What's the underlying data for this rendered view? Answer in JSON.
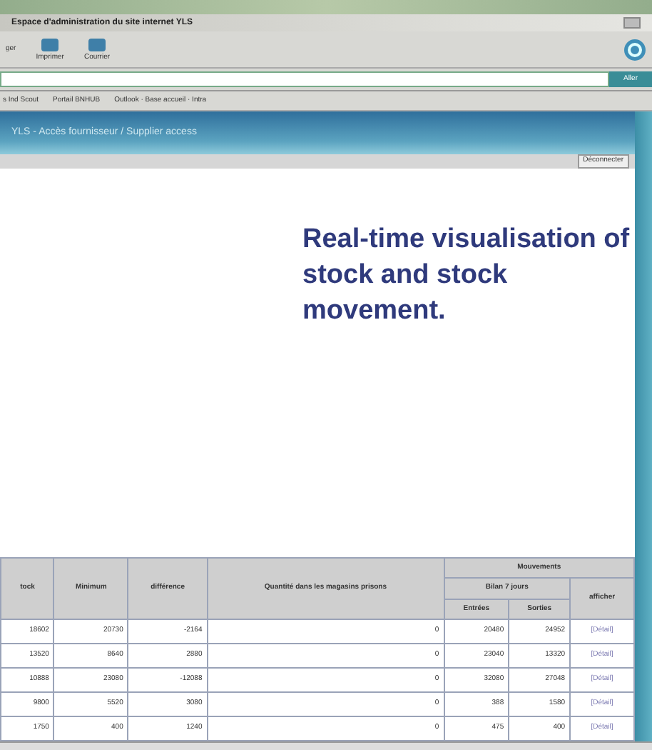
{
  "window": {
    "title": "Espace d'administration du site internet YLS"
  },
  "toolbar": {
    "buttons": [
      {
        "label": "ger"
      },
      {
        "label": "Imprimer"
      },
      {
        "label": "Courrier"
      }
    ]
  },
  "address_bar": {
    "go_button": "Aller"
  },
  "links_bar": {
    "items": [
      "s Ind Scout",
      "Portail BNHUB",
      "Outlook · Base accueil · Intra"
    ]
  },
  "header": {
    "title": "YLS - Accès fournisseur / Supplier access"
  },
  "subbar": {
    "link": "Déconnecter"
  },
  "headline": "Real-time visualisation of stock and stock movement.",
  "table": {
    "group_header": "Mouvements",
    "subgroup_header": "Bilan 7 jours",
    "columns": [
      "tock",
      "Minimum",
      "différence",
      "Quantité dans les magasins prisons",
      "Entrées",
      "Sorties",
      "afficher"
    ],
    "rows": [
      [
        "18602",
        "20730",
        "-2164",
        "0",
        "20480",
        "24952",
        "[Détail]"
      ],
      [
        "13520",
        "8640",
        "2880",
        "0",
        "23040",
        "13320",
        "[Détail]"
      ],
      [
        "10888",
        "23080",
        "-12088",
        "0",
        "32080",
        "27048",
        "[Détail]"
      ],
      [
        "9800",
        "5520",
        "3080",
        "0",
        "388",
        "1580",
        "[Détail]"
      ],
      [
        "1750",
        "400",
        "1240",
        "0",
        "475",
        "400",
        "[Détail]"
      ]
    ]
  }
}
